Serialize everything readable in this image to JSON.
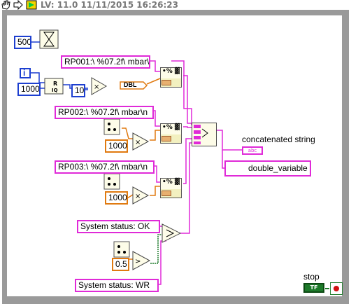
{
  "toolbar": {
    "title": "LV: 11.0 11/11/2015 16:26:23"
  },
  "wait": {
    "value": "500"
  },
  "format1": {
    "format_string": "RP001:\\ %07.2f\\ mbar\\n"
  },
  "format2": {
    "format_string": "RP002:\\ %07.2f\\ mbar\\n"
  },
  "format3": {
    "format_string": "RP003:\\ %07.2f\\ mbar\\n"
  },
  "iteration": {
    "label": "i"
  },
  "constants": {
    "c1000_a": "1000",
    "c10": "10",
    "c1000_b": "1000",
    "c1000_c": "1000",
    "c05": "0.5"
  },
  "conversion": {
    "label": "DBL"
  },
  "status": {
    "ok": "System status: OK",
    "wr": "System status: WR"
  },
  "outputs": {
    "concat_label": "concatenated string",
    "concat_indicator": "abc",
    "variable": "double_variable"
  },
  "stop": {
    "label": "stop",
    "control": "TF"
  },
  "fmt_glyph": "•% ▓",
  "colors": {
    "string_wire": "#e02ad8",
    "numeric_int": "#1d3fd0",
    "numeric_dbl": "#e07a10",
    "boolean": "#1d7a2a"
  }
}
